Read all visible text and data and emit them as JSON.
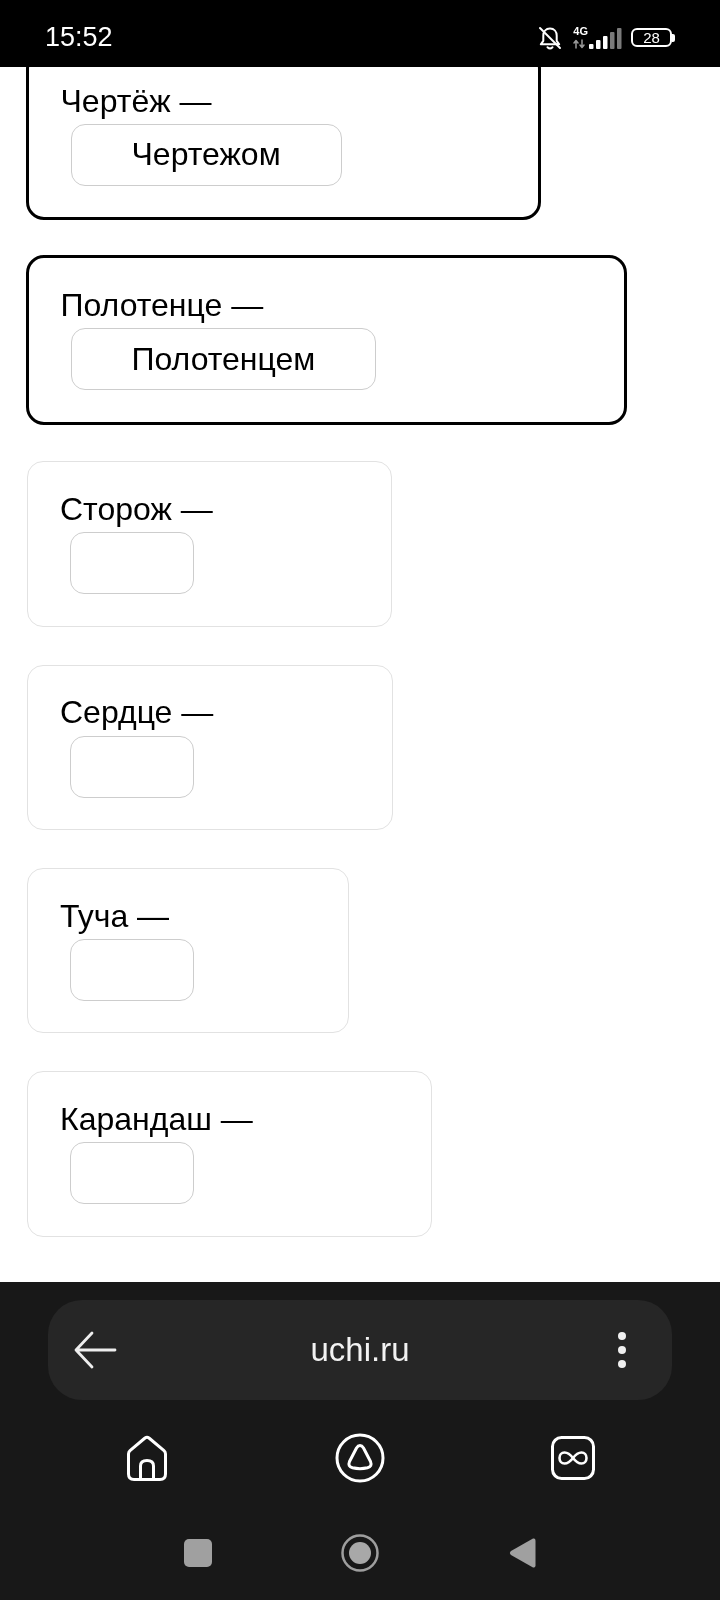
{
  "status_bar": {
    "time": "15:52",
    "network": "4G",
    "battery": "28"
  },
  "exercise": {
    "items": [
      {
        "word": "Чертёж —",
        "value": "Чертежом",
        "completed": true
      },
      {
        "word": "Полотенце —",
        "value": "Полотенцем",
        "completed": true
      },
      {
        "word": "Сторож —",
        "completed": false
      },
      {
        "word": "Сердце —",
        "completed": false
      },
      {
        "word": "Туча —",
        "completed": false
      },
      {
        "word": "Карандаш —",
        "completed": false
      }
    ]
  },
  "browser": {
    "url": "uchi.ru"
  }
}
